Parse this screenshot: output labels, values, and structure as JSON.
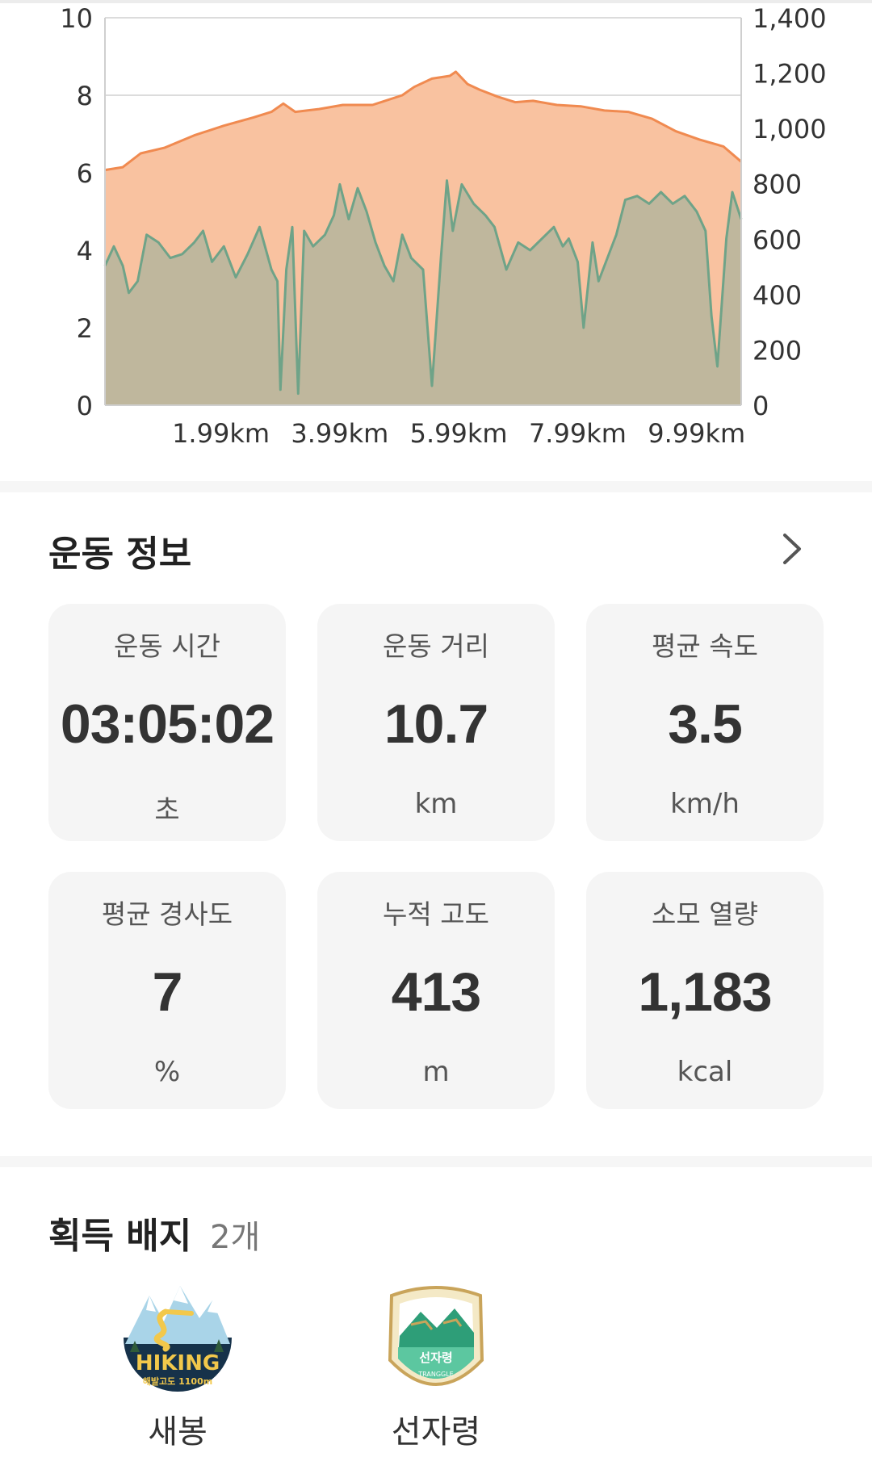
{
  "chart_data": {
    "type": "area",
    "x_tick_labels": [
      "1.99km",
      "3.99km",
      "5.99km",
      "7.99km",
      "9.99km"
    ],
    "x_ticks": [
      1.99,
      3.99,
      5.99,
      7.99,
      9.99
    ],
    "xlim": [
      0,
      10.7
    ],
    "y_left": {
      "ticks": [
        "0",
        "2",
        "4",
        "6",
        "8",
        "10"
      ],
      "ylim": [
        0,
        10
      ]
    },
    "y_right": {
      "ticks": [
        "0",
        "200",
        "400",
        "600",
        "800",
        "1,000",
        "1,200",
        "1,400"
      ],
      "ylim": [
        0,
        1400
      ]
    },
    "grid": true,
    "series": [
      {
        "axis": "right",
        "color": "#F08A50",
        "fill": "#F9C2A0",
        "points": [
          [
            0,
            850
          ],
          [
            0.3,
            860
          ],
          [
            0.6,
            910
          ],
          [
            1.0,
            930
          ],
          [
            1.5,
            975
          ],
          [
            2.0,
            1010
          ],
          [
            2.5,
            1040
          ],
          [
            2.8,
            1060
          ],
          [
            3.0,
            1090
          ],
          [
            3.2,
            1060
          ],
          [
            3.6,
            1070
          ],
          [
            4.0,
            1085
          ],
          [
            4.5,
            1085
          ],
          [
            5.0,
            1120
          ],
          [
            5.2,
            1150
          ],
          [
            5.5,
            1180
          ],
          [
            5.8,
            1190
          ],
          [
            5.9,
            1205
          ],
          [
            6.1,
            1160
          ],
          [
            6.3,
            1140
          ],
          [
            6.6,
            1115
          ],
          [
            6.9,
            1095
          ],
          [
            7.2,
            1100
          ],
          [
            7.6,
            1085
          ],
          [
            8.0,
            1080
          ],
          [
            8.4,
            1065
          ],
          [
            8.8,
            1060
          ],
          [
            9.2,
            1035
          ],
          [
            9.6,
            990
          ],
          [
            10.0,
            960
          ],
          [
            10.4,
            935
          ],
          [
            10.7,
            880
          ]
        ]
      },
      {
        "axis": "left",
        "color": "#6FA388",
        "fill": "#B5B59C",
        "points": [
          [
            0,
            3.6
          ],
          [
            0.15,
            4.1
          ],
          [
            0.3,
            3.6
          ],
          [
            0.4,
            2.9
          ],
          [
            0.55,
            3.2
          ],
          [
            0.7,
            4.4
          ],
          [
            0.9,
            4.2
          ],
          [
            1.1,
            3.8
          ],
          [
            1.3,
            3.9
          ],
          [
            1.5,
            4.2
          ],
          [
            1.65,
            4.5
          ],
          [
            1.8,
            3.7
          ],
          [
            2.0,
            4.1
          ],
          [
            2.2,
            3.3
          ],
          [
            2.4,
            3.9
          ],
          [
            2.6,
            4.6
          ],
          [
            2.8,
            3.5
          ],
          [
            2.9,
            3.2
          ],
          [
            2.95,
            0.4
          ],
          [
            3.05,
            3.5
          ],
          [
            3.15,
            4.6
          ],
          [
            3.25,
            0.3
          ],
          [
            3.35,
            4.5
          ],
          [
            3.5,
            4.1
          ],
          [
            3.7,
            4.4
          ],
          [
            3.85,
            4.9
          ],
          [
            3.95,
            5.7
          ],
          [
            4.1,
            4.8
          ],
          [
            4.25,
            5.6
          ],
          [
            4.4,
            5.0
          ],
          [
            4.55,
            4.2
          ],
          [
            4.7,
            3.6
          ],
          [
            4.85,
            3.2
          ],
          [
            5.0,
            4.4
          ],
          [
            5.15,
            3.8
          ],
          [
            5.35,
            3.5
          ],
          [
            5.5,
            0.5
          ],
          [
            5.65,
            3.8
          ],
          [
            5.75,
            5.8
          ],
          [
            5.85,
            4.5
          ],
          [
            6.0,
            5.7
          ],
          [
            6.2,
            5.2
          ],
          [
            6.4,
            4.9
          ],
          [
            6.55,
            4.6
          ],
          [
            6.75,
            3.5
          ],
          [
            6.95,
            4.2
          ],
          [
            7.15,
            4.0
          ],
          [
            7.35,
            4.3
          ],
          [
            7.55,
            4.6
          ],
          [
            7.7,
            4.1
          ],
          [
            7.8,
            4.3
          ],
          [
            7.95,
            3.7
          ],
          [
            8.05,
            2.0
          ],
          [
            8.2,
            4.2
          ],
          [
            8.3,
            3.2
          ],
          [
            8.45,
            3.8
          ],
          [
            8.6,
            4.4
          ],
          [
            8.75,
            5.3
          ],
          [
            8.95,
            5.4
          ],
          [
            9.15,
            5.2
          ],
          [
            9.35,
            5.5
          ],
          [
            9.55,
            5.2
          ],
          [
            9.75,
            5.4
          ],
          [
            9.95,
            5.0
          ],
          [
            10.1,
            4.5
          ],
          [
            10.2,
            2.3
          ],
          [
            10.3,
            1.0
          ],
          [
            10.45,
            4.3
          ],
          [
            10.55,
            5.5
          ],
          [
            10.7,
            4.8
          ]
        ]
      }
    ]
  },
  "workout": {
    "title": "운동 정보",
    "stats": [
      {
        "label": "운동 시간",
        "value": "03:05:02",
        "unit": "초"
      },
      {
        "label": "운동 거리",
        "value": "10.7",
        "unit": "km"
      },
      {
        "label": "평균 속도",
        "value": "3.5",
        "unit": "km/h"
      },
      {
        "label": "평균 경사도",
        "value": "7",
        "unit": "%"
      },
      {
        "label": "누적 고도",
        "value": "413",
        "unit": "m"
      },
      {
        "label": "소모 열량",
        "value": "1,183",
        "unit": "kcal"
      }
    ]
  },
  "badges": {
    "title": "획득 배지",
    "count": "2개",
    "items": [
      {
        "name": "새봉",
        "icon": "hiking-badge-icon",
        "art_text": "HIKING",
        "art_subtext": "해발고도 1100m"
      },
      {
        "name": "선자령",
        "icon": "seonjaryeong-badge-icon",
        "art_text": "선자령",
        "art_subtext": "TRANGGLE"
      }
    ]
  }
}
